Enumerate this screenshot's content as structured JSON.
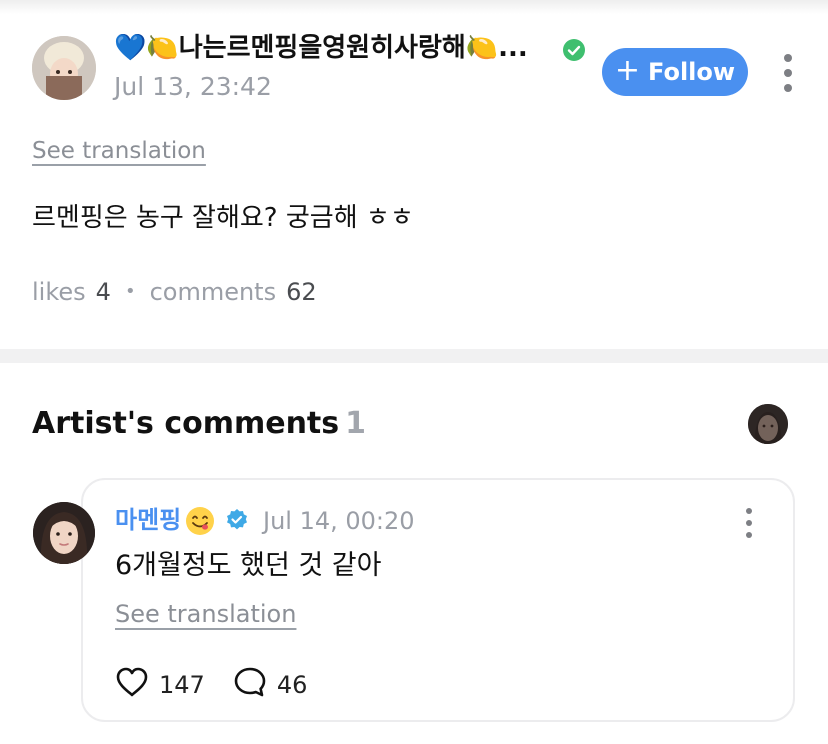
{
  "post": {
    "author_name": "💙🍋나는르멘핑을영원히사랑해🍋...",
    "date": "Jul 13, 23:42",
    "follow_label": "Follow",
    "see_translation": "See translation",
    "body": "르멘핑은 농구 잘해요? 궁금해 ㅎㅎ",
    "likes_label": "likes",
    "likes_count": "4",
    "comments_label": "comments",
    "comments_count": "62"
  },
  "artist_comments": {
    "title": "Artist's comments",
    "count": "1",
    "comment": {
      "name": "마멘핑",
      "date": "Jul 14, 00:20",
      "text": "6개월정도 했던 것 같아",
      "see_translation": "See translation",
      "likes": "147",
      "replies": "46"
    }
  },
  "icons": {
    "more": "more-vertical-icon",
    "verified_author": "verified-green-badge-icon",
    "verified_artist": "verified-blue-badge-icon",
    "heart": "heart-icon",
    "comment": "comment-bubble-icon",
    "plus": "plus-icon"
  },
  "colors": {
    "accent": "#4a90f0",
    "verified_green": "#3fbf6f",
    "muted_text": "#9a9ea6"
  }
}
